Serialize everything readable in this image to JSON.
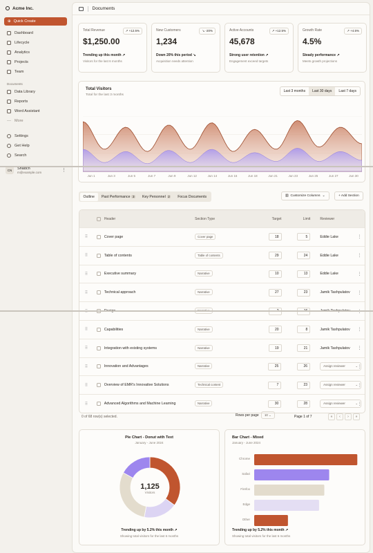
{
  "app": {
    "name": "Acme Inc.",
    "quick_create": "Quick Create",
    "page": "Documents"
  },
  "sidebar": {
    "items": [
      "Dashboard",
      "Lifecycle",
      "Analytics",
      "Projects",
      "Team"
    ],
    "docs_header": "Documents",
    "docs": [
      "Data Library",
      "Reports",
      "Word Assistant",
      "More"
    ],
    "bottom": [
      "Settings",
      "Get Help",
      "Search"
    ]
  },
  "user": {
    "initials": "CN",
    "name": "Shadcn",
    "email": "m@example.com"
  },
  "cards": [
    {
      "label": "Total Revenue",
      "badge": "↗ +12.5%",
      "value": "$1,250.00",
      "trend": "Trending up this month ↗",
      "sub": "Visitors for the last 6 months"
    },
    {
      "label": "New Customers",
      "badge": "↘ -20%",
      "value": "1,234",
      "trend": "Down 20% this period ↘",
      "sub": "Acquisition needs attention"
    },
    {
      "label": "Active Accounts",
      "badge": "↗ +12.5%",
      "value": "45,678",
      "trend": "Strong user retention ↗",
      "sub": "Engagement exceed targets"
    },
    {
      "label": "Growth Rate",
      "badge": "↗ +4.5%",
      "value": "4.5%",
      "trend": "Steady performance ↗",
      "sub": "Meets growth projections"
    }
  ],
  "visitors": {
    "title": "Total Visitors",
    "subtitle": "Total for the last 3 months",
    "ranges": [
      "Last 3 months",
      "Last 30 days",
      "Last 7 days"
    ],
    "selected": "Last 30 days"
  },
  "chart_data": {
    "type": "area",
    "x": [
      "Jun 1",
      "Jun 3",
      "Jun 5",
      "Jun 7",
      "Jun 9",
      "Jun 12",
      "Jun 14",
      "Jun 16",
      "Jun 18",
      "Jun 21",
      "Jun 23",
      "Jun 25",
      "Jun 27",
      "Jun 30"
    ],
    "series": [
      {
        "color": "#e9c8b8",
        "values": [
          45,
          20,
          40,
          18,
          42,
          20,
          44,
          18,
          38,
          20,
          46,
          22,
          40,
          25
        ]
      },
      {
        "color": "#d4ccf2",
        "values": [
          20,
          8,
          18,
          7,
          19,
          8,
          20,
          8,
          17,
          9,
          21,
          9,
          18,
          10
        ]
      }
    ]
  },
  "tabs": [
    {
      "label": "Outline",
      "count": ""
    },
    {
      "label": "Past Performance",
      "count": "3"
    },
    {
      "label": "Key Personnel",
      "count": "2"
    },
    {
      "label": "Focus Documents",
      "count": ""
    }
  ],
  "customize": "Customize Columns",
  "add_section": "+ Add Section",
  "table": {
    "headers": [
      "Header",
      "Section Type",
      "Target",
      "Limit",
      "Reviewer"
    ],
    "rows": [
      {
        "header": "Cover page",
        "type": "Cover page",
        "target": "18",
        "limit": "5",
        "reviewer": "Eddie Lake"
      },
      {
        "header": "Table of contents",
        "type": "Table of contents",
        "target": "29",
        "limit": "24",
        "reviewer": "Eddie Lake"
      },
      {
        "header": "Executive summary",
        "type": "Narrative",
        "target": "10",
        "limit": "13",
        "reviewer": "Eddie Lake"
      },
      {
        "header": "Technical approach",
        "type": "Narrative",
        "target": "27",
        "limit": "23",
        "reviewer": "Jamik Tashpulatov"
      },
      {
        "header": "Design",
        "type": "Narrative",
        "target": "2",
        "limit": "16",
        "reviewer": "Jamik Tashpulatov"
      },
      {
        "header": "Capabilities",
        "type": "Narrative",
        "target": "20",
        "limit": "8",
        "reviewer": "Jamik Tashpulatov"
      },
      {
        "header": "Integration with existing systems",
        "type": "Narrative",
        "target": "19",
        "limit": "21",
        "reviewer": "Jamik Tashpulatov"
      },
      {
        "header": "Innovation and Advantages",
        "type": "Narrative",
        "target": "25",
        "limit": "26",
        "reviewer": "Assign reviewer"
      },
      {
        "header": "Overview of EMR's Innovative Solutions",
        "type": "Technical content",
        "target": "7",
        "limit": "23",
        "reviewer": "Assign reviewer"
      },
      {
        "header": "Advanced Algorithms and Machine Learning",
        "type": "Narrative",
        "target": "30",
        "limit": "28",
        "reviewer": "Assign reviewer"
      }
    ]
  },
  "footer": {
    "selected": "0 of 68 row(s) selected.",
    "rows_per_page": "Rows per page",
    "rpp_value": "10",
    "page": "Page 1 of 7"
  },
  "pie": {
    "title": "Pie Chart - Donut with Text",
    "range": "January - June 2024",
    "center_value": "1,125",
    "center_label": "Visitors",
    "trend": "Trending up by 5.2% this month ↗",
    "sub": "Showing total visitors for the last 6 months",
    "slices": [
      {
        "value": 35,
        "color": "#c0552f"
      },
      {
        "value": 18,
        "color": "#dcd4f3"
      },
      {
        "value": 30,
        "color": "#e3dccd"
      },
      {
        "value": 17,
        "color": "#9d86ee"
      }
    ]
  },
  "bar": {
    "title": "Bar Chart - Mixed",
    "range": "January - June 2024",
    "categories": [
      "Chrome",
      "Safari",
      "Firefox",
      "Edge",
      "Other"
    ],
    "values": [
      275,
      200,
      187,
      173,
      90
    ],
    "colors": [
      "#c0552f",
      "#9d86ee",
      "#e3dccd",
      "#e4def3",
      "#c0552f"
    ],
    "trend": "Trending up by 5.2% this month ↗",
    "sub": "Showing total visitors for the last 6 months"
  }
}
